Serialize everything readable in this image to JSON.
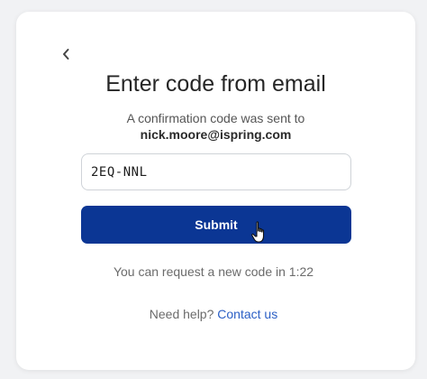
{
  "back": {
    "icon": "chevron-left-icon"
  },
  "title": "Enter code from email",
  "subtitle": {
    "line1": "A confirmation code was sent to",
    "email": "nick.moore@ispring.com"
  },
  "code_input": {
    "value": "2EQ-NNL"
  },
  "submit_label": "Submit",
  "resend_text": "You can request a new code in 1:22",
  "help": {
    "prefix": "Need help?",
    "link": "Contact us"
  },
  "colors": {
    "primary": "#0b3694",
    "link": "#2b5fc5",
    "background": "#f1f2f4"
  }
}
